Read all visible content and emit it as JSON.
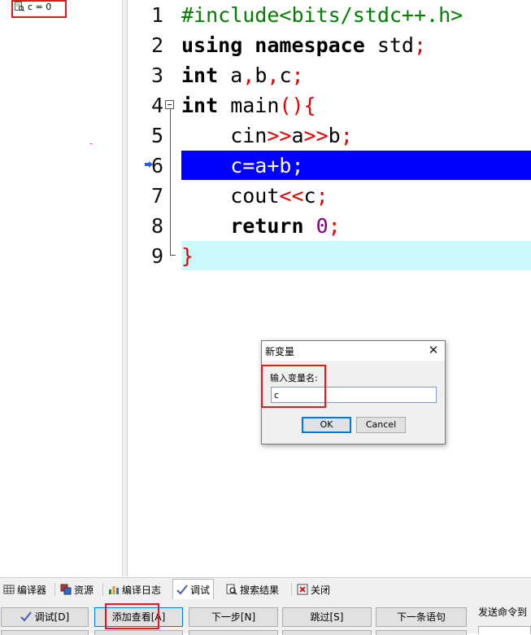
{
  "watch": {
    "items": [
      {
        "text": "c = 0"
      }
    ]
  },
  "editor": {
    "lines": [
      {
        "num": "1",
        "tokens": [
          {
            "t": "#include<bits/stdc++.h>",
            "c": "pp"
          }
        ]
      },
      {
        "num": "2",
        "tokens": [
          {
            "t": "using namespace",
            "c": "kw"
          },
          {
            "t": " std",
            "c": "plain"
          },
          {
            "t": ";",
            "c": "sym"
          }
        ]
      },
      {
        "num": "3",
        "tokens": [
          {
            "t": "int",
            "c": "kw"
          },
          {
            "t": " a",
            "c": "plain"
          },
          {
            "t": ",",
            "c": "sym"
          },
          {
            "t": "b",
            "c": "plain"
          },
          {
            "t": ",",
            "c": "sym"
          },
          {
            "t": "c",
            "c": "plain"
          },
          {
            "t": ";",
            "c": "sym"
          }
        ]
      },
      {
        "num": "4",
        "tokens": [
          {
            "t": "int",
            "c": "kw"
          },
          {
            "t": " main",
            "c": "plain"
          },
          {
            "t": "(){",
            "c": "sym"
          }
        ]
      },
      {
        "num": "5",
        "tokens": [
          {
            "t": "    cin",
            "c": "plain"
          },
          {
            "t": ">>",
            "c": "sym"
          },
          {
            "t": "a",
            "c": "plain"
          },
          {
            "t": ">>",
            "c": "sym"
          },
          {
            "t": "b",
            "c": "plain"
          },
          {
            "t": ";",
            "c": "sym"
          }
        ]
      },
      {
        "num": "6",
        "tokens": [
          {
            "t": "    c=a+b;",
            "c": "sel"
          }
        ]
      },
      {
        "num": "7",
        "tokens": [
          {
            "t": "    cout",
            "c": "plain"
          },
          {
            "t": "<<",
            "c": "sym"
          },
          {
            "t": "c",
            "c": "plain"
          },
          {
            "t": ";",
            "c": "sym"
          }
        ]
      },
      {
        "num": "8",
        "tokens": [
          {
            "t": "    ",
            "c": "plain"
          },
          {
            "t": "return",
            "c": "kw"
          },
          {
            "t": " ",
            "c": "plain"
          },
          {
            "t": "0",
            "c": "num"
          },
          {
            "t": ";",
            "c": "sym"
          }
        ]
      },
      {
        "num": "9",
        "tokens": [
          {
            "t": "}",
            "c": "sym"
          }
        ]
      }
    ]
  },
  "dialog": {
    "title": "新变量",
    "close_glyph": "✕",
    "label": "输入变量名:",
    "input_value": "c",
    "ok_label": "OK",
    "cancel_label": "Cancel"
  },
  "tabs": [
    {
      "label": "编译器",
      "icon": "compiler-grid-icon",
      "active": false
    },
    {
      "label": "资源",
      "icon": "resources-icon",
      "active": false
    },
    {
      "label": "编译日志",
      "icon": "compile-log-chart-icon",
      "active": false
    },
    {
      "label": "调试",
      "icon": "debug-check-icon",
      "active": true
    },
    {
      "label": "搜索结果",
      "icon": "search-results-icon",
      "active": false
    },
    {
      "label": "关闭",
      "icon": "close-tab-icon",
      "active": false
    }
  ],
  "toolbar": {
    "debug_label": "调试[D]",
    "add_watch_label": "添加查看[A]",
    "next_step_label": "下一步[N]",
    "skip_label": "跳过[S]",
    "next_statement_label": "下一条语句",
    "send_command_label": "发送命令到"
  },
  "colors": {
    "highlight_blue": "#0000ff",
    "highlight_cyan": "#ccfafa",
    "annotation_red": "#e0191e",
    "preprocessor_green": "#008000",
    "symbol_red": "#e00000",
    "number_purple": "#800080"
  }
}
